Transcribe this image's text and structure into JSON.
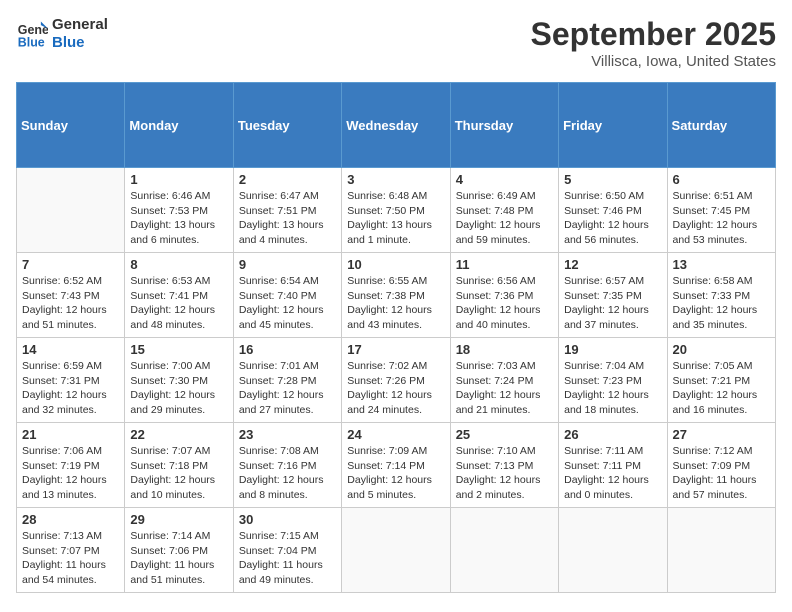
{
  "header": {
    "logo_line1": "General",
    "logo_line2": "Blue",
    "month": "September 2025",
    "location": "Villisca, Iowa, United States"
  },
  "weekdays": [
    "Sunday",
    "Monday",
    "Tuesday",
    "Wednesday",
    "Thursday",
    "Friday",
    "Saturday"
  ],
  "weeks": [
    [
      {
        "day": "",
        "info": ""
      },
      {
        "day": "1",
        "info": "Sunrise: 6:46 AM\nSunset: 7:53 PM\nDaylight: 13 hours\nand 6 minutes."
      },
      {
        "day": "2",
        "info": "Sunrise: 6:47 AM\nSunset: 7:51 PM\nDaylight: 13 hours\nand 4 minutes."
      },
      {
        "day": "3",
        "info": "Sunrise: 6:48 AM\nSunset: 7:50 PM\nDaylight: 13 hours\nand 1 minute."
      },
      {
        "day": "4",
        "info": "Sunrise: 6:49 AM\nSunset: 7:48 PM\nDaylight: 12 hours\nand 59 minutes."
      },
      {
        "day": "5",
        "info": "Sunrise: 6:50 AM\nSunset: 7:46 PM\nDaylight: 12 hours\nand 56 minutes."
      },
      {
        "day": "6",
        "info": "Sunrise: 6:51 AM\nSunset: 7:45 PM\nDaylight: 12 hours\nand 53 minutes."
      }
    ],
    [
      {
        "day": "7",
        "info": "Sunrise: 6:52 AM\nSunset: 7:43 PM\nDaylight: 12 hours\nand 51 minutes."
      },
      {
        "day": "8",
        "info": "Sunrise: 6:53 AM\nSunset: 7:41 PM\nDaylight: 12 hours\nand 48 minutes."
      },
      {
        "day": "9",
        "info": "Sunrise: 6:54 AM\nSunset: 7:40 PM\nDaylight: 12 hours\nand 45 minutes."
      },
      {
        "day": "10",
        "info": "Sunrise: 6:55 AM\nSunset: 7:38 PM\nDaylight: 12 hours\nand 43 minutes."
      },
      {
        "day": "11",
        "info": "Sunrise: 6:56 AM\nSunset: 7:36 PM\nDaylight: 12 hours\nand 40 minutes."
      },
      {
        "day": "12",
        "info": "Sunrise: 6:57 AM\nSunset: 7:35 PM\nDaylight: 12 hours\nand 37 minutes."
      },
      {
        "day": "13",
        "info": "Sunrise: 6:58 AM\nSunset: 7:33 PM\nDaylight: 12 hours\nand 35 minutes."
      }
    ],
    [
      {
        "day": "14",
        "info": "Sunrise: 6:59 AM\nSunset: 7:31 PM\nDaylight: 12 hours\nand 32 minutes."
      },
      {
        "day": "15",
        "info": "Sunrise: 7:00 AM\nSunset: 7:30 PM\nDaylight: 12 hours\nand 29 minutes."
      },
      {
        "day": "16",
        "info": "Sunrise: 7:01 AM\nSunset: 7:28 PM\nDaylight: 12 hours\nand 27 minutes."
      },
      {
        "day": "17",
        "info": "Sunrise: 7:02 AM\nSunset: 7:26 PM\nDaylight: 12 hours\nand 24 minutes."
      },
      {
        "day": "18",
        "info": "Sunrise: 7:03 AM\nSunset: 7:24 PM\nDaylight: 12 hours\nand 21 minutes."
      },
      {
        "day": "19",
        "info": "Sunrise: 7:04 AM\nSunset: 7:23 PM\nDaylight: 12 hours\nand 18 minutes."
      },
      {
        "day": "20",
        "info": "Sunrise: 7:05 AM\nSunset: 7:21 PM\nDaylight: 12 hours\nand 16 minutes."
      }
    ],
    [
      {
        "day": "21",
        "info": "Sunrise: 7:06 AM\nSunset: 7:19 PM\nDaylight: 12 hours\nand 13 minutes."
      },
      {
        "day": "22",
        "info": "Sunrise: 7:07 AM\nSunset: 7:18 PM\nDaylight: 12 hours\nand 10 minutes."
      },
      {
        "day": "23",
        "info": "Sunrise: 7:08 AM\nSunset: 7:16 PM\nDaylight: 12 hours\nand 8 minutes."
      },
      {
        "day": "24",
        "info": "Sunrise: 7:09 AM\nSunset: 7:14 PM\nDaylight: 12 hours\nand 5 minutes."
      },
      {
        "day": "25",
        "info": "Sunrise: 7:10 AM\nSunset: 7:13 PM\nDaylight: 12 hours\nand 2 minutes."
      },
      {
        "day": "26",
        "info": "Sunrise: 7:11 AM\nSunset: 7:11 PM\nDaylight: 12 hours\nand 0 minutes."
      },
      {
        "day": "27",
        "info": "Sunrise: 7:12 AM\nSunset: 7:09 PM\nDaylight: 11 hours\nand 57 minutes."
      }
    ],
    [
      {
        "day": "28",
        "info": "Sunrise: 7:13 AM\nSunset: 7:07 PM\nDaylight: 11 hours\nand 54 minutes."
      },
      {
        "day": "29",
        "info": "Sunrise: 7:14 AM\nSunset: 7:06 PM\nDaylight: 11 hours\nand 51 minutes."
      },
      {
        "day": "30",
        "info": "Sunrise: 7:15 AM\nSunset: 7:04 PM\nDaylight: 11 hours\nand 49 minutes."
      },
      {
        "day": "",
        "info": ""
      },
      {
        "day": "",
        "info": ""
      },
      {
        "day": "",
        "info": ""
      },
      {
        "day": "",
        "info": ""
      }
    ]
  ]
}
